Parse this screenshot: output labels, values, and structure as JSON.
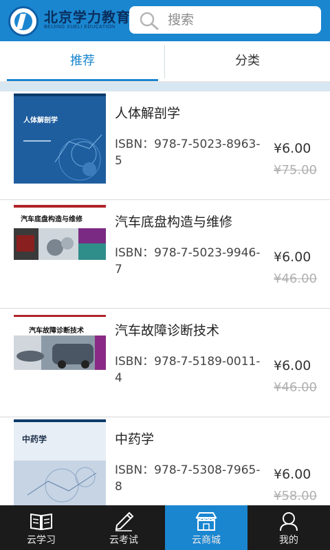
{
  "header": {
    "brand_cn": "北京学力教育",
    "brand_en": "BEIJING XUELI EDUCATION",
    "search_placeholder": "搜索"
  },
  "tabs": [
    {
      "label": "推荐",
      "active": true
    },
    {
      "label": "分类",
      "active": false
    }
  ],
  "books": [
    {
      "title": "人体解剖学",
      "cover_title": "人体解剖学",
      "isbn": "ISBN：978-7-5023-8963-5",
      "price": "¥6.00",
      "original_price": "¥75.00"
    },
    {
      "title": "汽车底盘构造与维修",
      "cover_title": "汽车底盘构造与维修",
      "isbn": "ISBN：978-7-5023-9946-7",
      "price": "¥6.00",
      "original_price": "¥46.00"
    },
    {
      "title": "汽车故障诊断技术",
      "cover_title": "汽车故障诊断技术",
      "isbn": "ISBN：978-7-5189-0011-4",
      "price": "¥6.00",
      "original_price": "¥46.00"
    },
    {
      "title": "中药学",
      "cover_title": "中药学",
      "isbn": "ISBN：978-7-5308-7965-8",
      "price": "¥6.00",
      "original_price": "¥58.00"
    }
  ],
  "nav": [
    {
      "label": "云学习",
      "icon": "book-icon",
      "active": false
    },
    {
      "label": "云考试",
      "icon": "pen-icon",
      "active": false
    },
    {
      "label": "云商城",
      "icon": "store-icon",
      "active": true
    },
    {
      "label": "我的",
      "icon": "user-icon",
      "active": false
    }
  ],
  "colors": {
    "accent": "#1a86d0",
    "navbar": "#1b1b1b",
    "strikethrough": "#b0b0b0"
  }
}
